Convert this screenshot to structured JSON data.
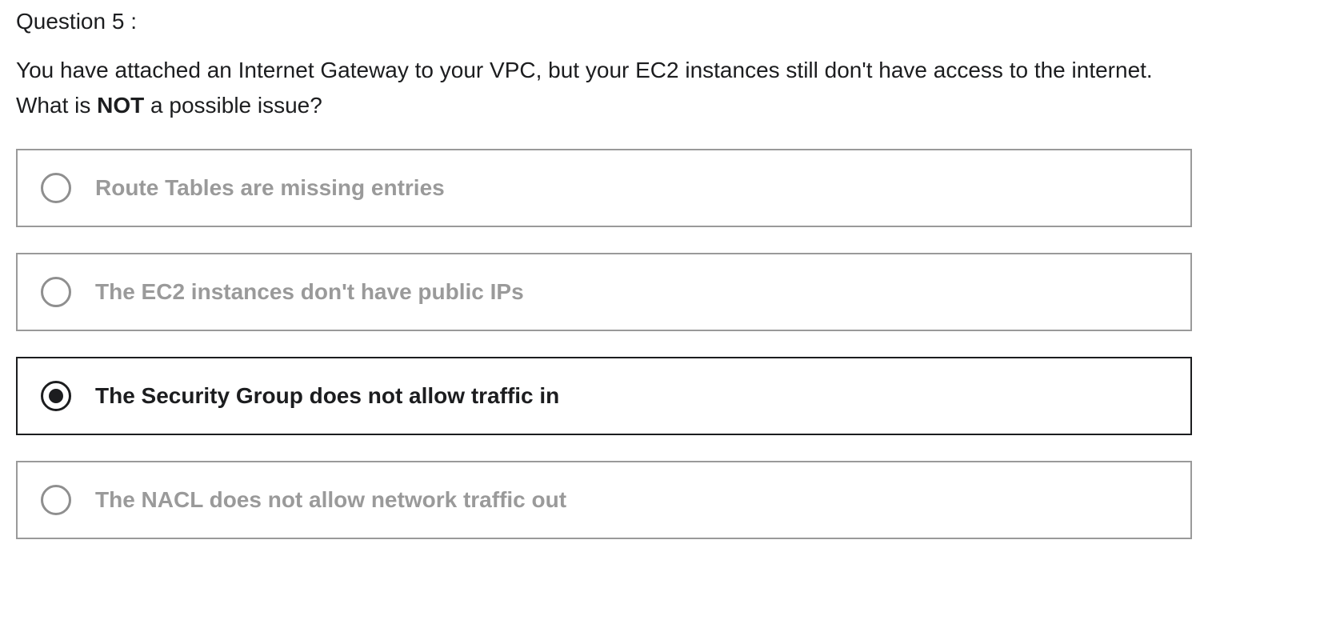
{
  "question": {
    "number_label": "Question 5 :",
    "text_before": "You have attached an Internet Gateway to your VPC, but your EC2 instances still don't have access to the internet. What is ",
    "text_emphasis": "NOT",
    "text_after": " a possible issue?"
  },
  "options": [
    {
      "label": "Route Tables are missing entries",
      "selected": false
    },
    {
      "label": "The EC2 instances don't have public IPs",
      "selected": false
    },
    {
      "label": "The Security Group does not allow traffic in",
      "selected": true
    },
    {
      "label": "The NACL does not allow network traffic out",
      "selected": false
    }
  ],
  "colors": {
    "text": "#1c1d1f",
    "muted": "#9a9a9a",
    "border": "#9a9a9a",
    "selected_border": "#1c1d1f"
  },
  "icons": {
    "radio_unselected": "radio-unselected-icon",
    "radio_selected": "radio-selected-icon"
  }
}
